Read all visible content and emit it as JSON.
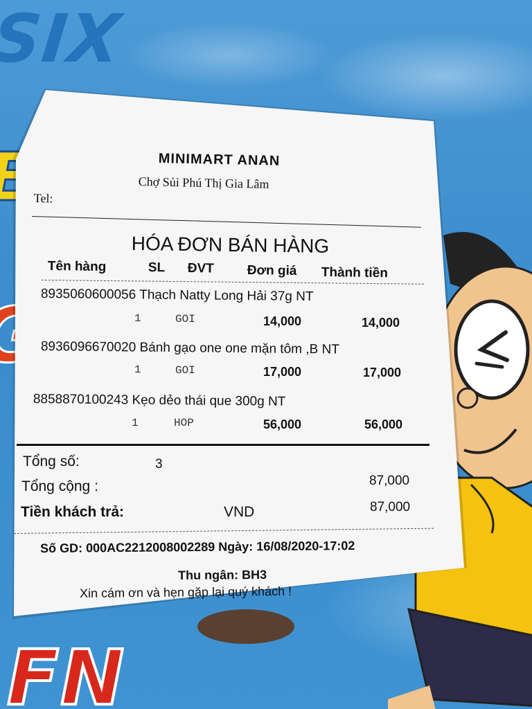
{
  "poster": {
    "top_text": "SIX",
    "mid_text": "EV",
    "g_text": "G",
    "bottom_text": "FN"
  },
  "receipt": {
    "store_name": "MINIMART ANAN",
    "store_address": "Chợ Sủi Phú Thị Gia Lâm",
    "tel_label": "Tel:",
    "title": "HÓA ĐƠN BÁN HÀNG",
    "columns": [
      "Tên hàng",
      "SL",
      "ĐVT",
      "Đơn giá",
      "Thành tiền"
    ],
    "items": [
      {
        "code_name": "8935060600056 Thạch Natty Long Hải 37g NT",
        "qty": "1",
        "unit": "GOI",
        "price": "14,000",
        "total": "14,000"
      },
      {
        "code_name": "8936096670020 Bánh gạo one one mặn tôm ,B NT",
        "qty": "1",
        "unit": "GOI",
        "price": "17,000",
        "total": "17,000"
      },
      {
        "code_name": "8858870100243 Kẹo dẻo thái que 300g NT",
        "qty": "1",
        "unit": "HOP",
        "price": "56,000",
        "total": "56,000"
      }
    ],
    "summary": {
      "count_label": "Tổng số:",
      "count_value": "3",
      "subtotal_label": "Tổng cộng :",
      "subtotal_value": "87,000",
      "paid_label": "Tiền khách trả:",
      "paid_currency": "VND",
      "paid_value": "87,000"
    },
    "footer": {
      "transaction": "Số GD: 000AC2212008002289 Ngày: 16/08/2020-17:02",
      "cashier": "Thu ngân: BH3",
      "thanks": "Xin cám ơn và hẹn gặp lại quý khách !"
    }
  },
  "colors": {
    "background": "#3f8fd0",
    "paper": "#f6f6f6",
    "ink": "#111111",
    "poster_yellow": "#f3d21a",
    "poster_red": "#d8281c"
  }
}
